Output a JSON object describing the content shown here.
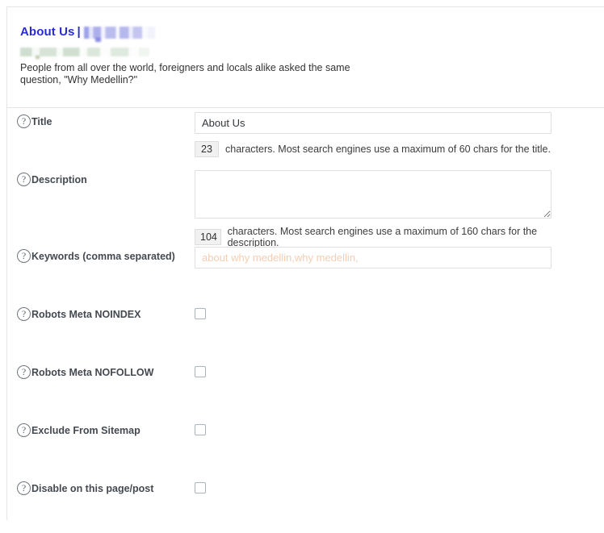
{
  "preview": {
    "title_text": "About Us",
    "title_separator": "|",
    "redacted_site_name": "",
    "redacted_url": "",
    "description": "People from all over the world, foreigners and locals alike asked the same question, \"Why Medellin?\""
  },
  "help_icon_glyph": "?",
  "fields": {
    "title": {
      "label": "Title",
      "help_icon": "question-mark-icon",
      "value": "About Us",
      "placeholder": "",
      "counter": "23",
      "counter_help": "characters. Most search engines use a maximum of 60 chars for the title."
    },
    "description": {
      "label": "Description",
      "help_icon": "question-mark-icon",
      "value": "",
      "placeholder": "",
      "counter": "104",
      "counter_help": "characters. Most search engines use a maximum of 160 chars for the description."
    },
    "keywords": {
      "label": "Keywords (comma separated)",
      "help_icon": "question-mark-icon",
      "value": "",
      "placeholder": "about why medellin,why medellin,"
    }
  },
  "checkboxes": [
    {
      "label": "Robots Meta NOINDEX",
      "checked": false,
      "help_icon": "question-mark-icon"
    },
    {
      "label": "Robots Meta NOFOLLOW",
      "checked": false,
      "help_icon": "question-mark-icon"
    },
    {
      "label": "Exclude From Sitemap",
      "checked": false,
      "help_icon": "question-mark-icon"
    },
    {
      "label": "Disable on this page/post",
      "checked": false,
      "help_icon": "question-mark-icon"
    }
  ],
  "colors": {
    "serp_title": "#2b2bd6",
    "placeholder": "#f3cbb0",
    "panel_border": "#e5e5e5",
    "input_border": "#dfdfdf",
    "counter_bg": "#f1f1f1"
  }
}
